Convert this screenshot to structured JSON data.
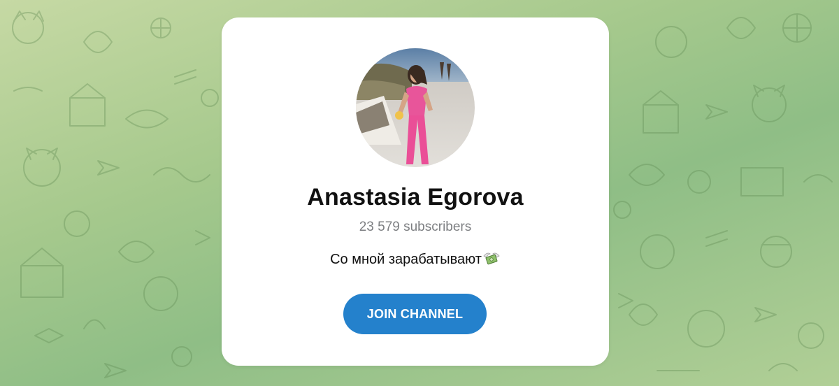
{
  "theme": {
    "accent": "#2481cc",
    "card_background": "#ffffff",
    "pattern_color": "#5f8a52"
  },
  "background": {
    "pattern_icon": "telegram-doodle-pattern"
  },
  "channel": {
    "avatar_icon": "channel-avatar-photo",
    "title": "Anastasia Egorova",
    "subscribers": "23 579 subscribers",
    "description": "Со мной зарабатывают",
    "description_emoji_icon": "money-with-wings-icon"
  },
  "actions": {
    "join_label": "JOIN CHANNEL"
  }
}
